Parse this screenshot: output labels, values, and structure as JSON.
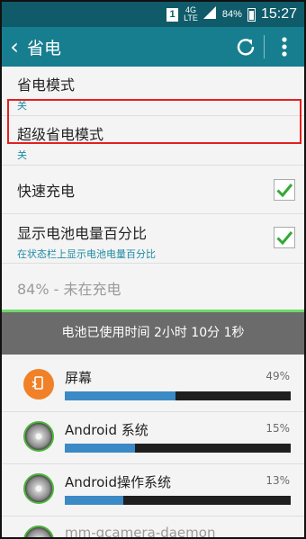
{
  "status_bar": {
    "sim": "1",
    "network": "4G",
    "network_sub": "LTE",
    "battery_pct": "84%",
    "time": "15:27"
  },
  "app_bar": {
    "back_icon": "chevron-left",
    "title": "省电",
    "refresh_icon": "refresh",
    "more_icon": "more-vertical"
  },
  "settings": [
    {
      "title": "省电模式",
      "subtitle": "关"
    },
    {
      "title": "超级省电模式",
      "subtitle": "关"
    },
    {
      "title": "快速充电",
      "checked": true
    },
    {
      "title": "显示电池电量百分比",
      "subtitle": "在状态栏上显示电池电量百分比",
      "checked": true
    },
    {
      "title": "84% - 未在充电"
    }
  ],
  "accent_colors": {
    "appbar": "#177e8f",
    "check": "#31a936",
    "highlight": "#e2201e",
    "usage_bar": "#3b8ac6"
  },
  "battery_graph": {
    "usage_time": "电池已使用时间 2小时 10分 1秒"
  },
  "apps": [
    {
      "name": "屏幕",
      "percent": "49%",
      "fraction": 0.49,
      "icon": "screen-icon"
    },
    {
      "name": "Android 系统",
      "percent": "15%",
      "fraction": 0.31,
      "icon": "disk-icon"
    },
    {
      "name": "Android操作系统",
      "percent": "13%",
      "fraction": 0.26,
      "icon": "disk-icon"
    },
    {
      "name": "mm-qcamera-daemon",
      "percent": "",
      "icon": "disk-icon"
    }
  ]
}
